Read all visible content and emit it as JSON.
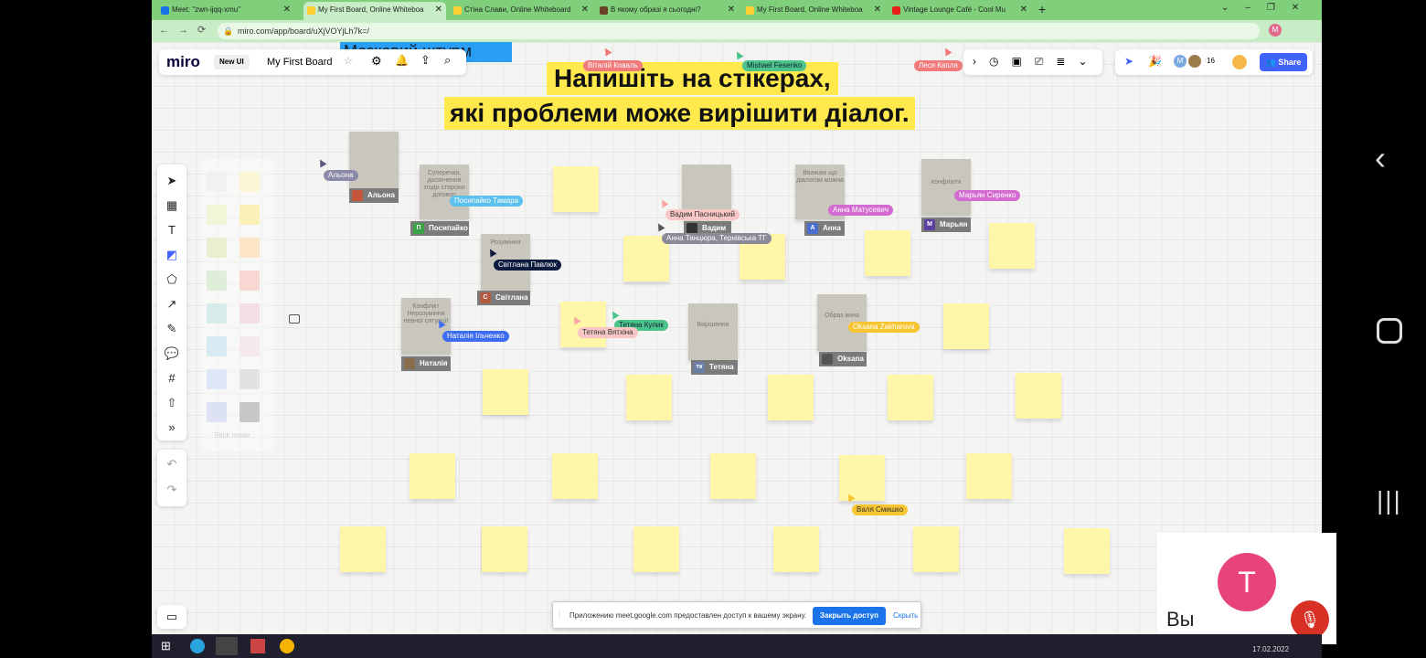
{
  "tabs": [
    {
      "label": "Meet: \"zwn-ijqq-xmu\"",
      "color": "#1a73e8"
    },
    {
      "label": "My First Board, Online Whiteboa",
      "color": "#ffd02f"
    },
    {
      "label": "Стіна Слави, Online Whiteboard",
      "color": "#ffd02f"
    },
    {
      "label": "В якому образі я сьогодні?",
      "color": "#6b4226"
    },
    {
      "label": "My First Board, Online Whiteboa",
      "color": "#ffd02f"
    },
    {
      "label": "Vintage Lounge Café - Cool Mu",
      "color": "#e62117"
    }
  ],
  "url": "miro.com/app/board/uXjVOYjLh7k=/",
  "miro": {
    "logo": "miro",
    "badge": "New UI",
    "board_name": "My First Board",
    "user_count": "16",
    "share_label": "Share",
    "top_text": "Мозковий штурм"
  },
  "title": {
    "line1": "Напишіть на стікерах,",
    "line2": "які проблеми може вирішити діалог."
  },
  "gray_stickies": [
    {
      "text": "",
      "name": "Альона"
    },
    {
      "text": "Суперечка, досягнення згоди сторони договор",
      "name": "Посипайко"
    },
    {
      "text": "Розуміння",
      "name": "Світлана"
    },
    {
      "text": "",
      "name": "Вадим"
    },
    {
      "text": "Вважаю що діалогом можна",
      "name": "Анна"
    },
    {
      "text": "конфлікти",
      "name": "Марьян"
    },
    {
      "text": "Конфлікт Нерозуміння певної ситуації",
      "name": "Наталія"
    },
    {
      "text": "Вирішення",
      "name": "Тетяна"
    },
    {
      "text": "Образ вина",
      "name": "Oksana"
    }
  ],
  "cursor_labels": [
    {
      "text": "Віталій Коваль",
      "color": "#f07a7a"
    },
    {
      "text": "Mishael Fesenko",
      "color": "#4cc38a"
    },
    {
      "text": "Леся Капля",
      "color": "#f07a7a"
    },
    {
      "text": "Альона",
      "color": "#8b8aa8"
    },
    {
      "text": "Посипайко Тамара",
      "color": "#5bc0eb"
    },
    {
      "text": "Світлана Павлюк",
      "color": "#0d1b3e"
    },
    {
      "text": "Вадим Пасницький",
      "color": "#f9c6c6"
    },
    {
      "text": "Анна Танцюра, Тернівська ТГ",
      "color": "#8a8a98"
    },
    {
      "text": "Анна Матусевич",
      "color": "#d36bd0"
    },
    {
      "text": "Марьян Сиренко",
      "color": "#d36bd0"
    },
    {
      "text": "Наталія Ільченко",
      "color": "#3d6cf0"
    },
    {
      "text": "Тетяна Кулик",
      "color": "#4cc38a"
    },
    {
      "text": "Тетяна Вятхіна",
      "color": "#f9c6c6"
    },
    {
      "text": "Oksana Zakharova",
      "color": "#f7c531"
    },
    {
      "text": "Валя Смишко",
      "color": "#f7c531"
    }
  ],
  "sidebar": {
    "hint": "Stick mode"
  },
  "notice": {
    "text": "Приложению meet.google.com предоставлен доступ к вашему экрану.",
    "primary": "Закрыть доступ",
    "secondary": "Скрыть"
  },
  "meet": {
    "initial": "T",
    "you": "Вы",
    "date": "17.02.2022"
  }
}
